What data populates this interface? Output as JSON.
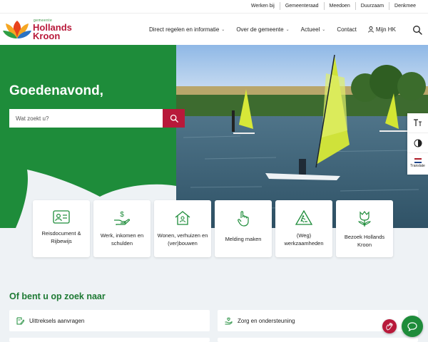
{
  "topbar": {
    "links": [
      "Werken bij",
      "Gemeenteraad",
      "Meedoen",
      "Duurzaam",
      "Denkmee"
    ]
  },
  "logo": {
    "prefix": "gemeente",
    "name_line1": "Hollands",
    "name_line2": "Kroon"
  },
  "nav": {
    "items": [
      {
        "label": "Direct regelen en informatie",
        "dropdown": true
      },
      {
        "label": "Over de gemeente",
        "dropdown": true
      },
      {
        "label": "Actueel",
        "dropdown": true
      },
      {
        "label": "Contact",
        "dropdown": false
      }
    ],
    "account_label": "Mijn HK",
    "search_icon": "search-icon"
  },
  "hero": {
    "greeting": "Goedenavond,",
    "search_placeholder": "Wat zoekt u?"
  },
  "side_tools": {
    "text_size_icon": "text-size-icon",
    "contrast_icon": "contrast-icon",
    "translate_label": "Translate"
  },
  "tiles": [
    {
      "label_line1": "Reisdocument &",
      "label_line2": "Rijbewijs",
      "icon": "id-card-icon"
    },
    {
      "label_line1": "Werk, inkomen en",
      "label_line2": "schulden",
      "icon": "money-hand-icon"
    },
    {
      "label_line1": "Wonen, verhuizen en",
      "label_line2": "(ver)bouwen",
      "icon": "house-icon"
    },
    {
      "label_line1": "Melding maken",
      "label_line2": "",
      "icon": "pointing-hand-icon"
    },
    {
      "label_line1": "(Weg)",
      "label_line2": "werkzaamheden",
      "icon": "road-works-icon"
    },
    {
      "label_line1": "Bezoek Hollands",
      "label_line2": "Kroon",
      "icon": "tulip-icon"
    }
  ],
  "section": {
    "title": "Of bent u op zoek naar",
    "links": [
      {
        "label": "Uittreksels aanvragen",
        "icon": "document-pen-icon"
      },
      {
        "label": "Zorg en ondersteuning",
        "icon": "care-hand-icon"
      }
    ]
  },
  "colors": {
    "brand_green": "#1e8c3a",
    "brand_red": "#b8193a",
    "background": "#eef2f5"
  }
}
